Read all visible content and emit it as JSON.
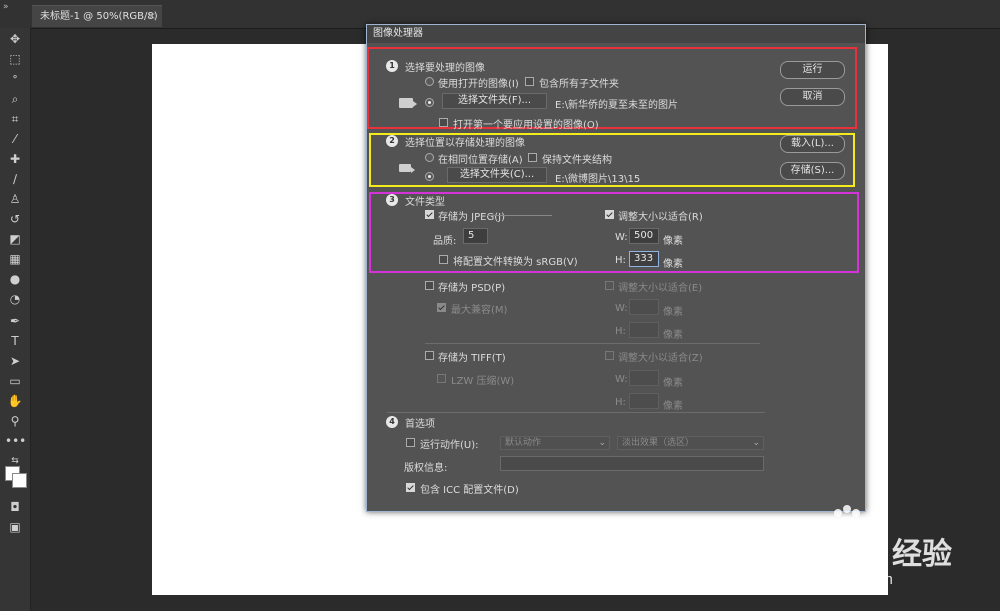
{
  "app": {
    "doc_tab": "未标题-1 @ 50%(RGB/8)",
    "tab_close": "×",
    "collapse": "»"
  },
  "dialog": {
    "title": "图像处理器",
    "sec1": {
      "num": "1",
      "heading": "选择要处理的图像",
      "use_open": "使用打开的图像(I)",
      "include_sub": "包含所有子文件夹",
      "select_folder": "选择文件夹(F)...",
      "folder_path": "E:\\新华侨的夏至未至的图片",
      "open_first": "打开第一个要应用设置的图像(O)"
    },
    "sec2": {
      "num": "2",
      "heading": "选择位置以存储处理的图像",
      "same_location": "在相同位置存储(A)",
      "keep_structure": "保持文件夹结构",
      "select_folder": "选择文件夹(C)...",
      "folder_path": "E:\\微博图片\\13\\15"
    },
    "sec3": {
      "num": "3",
      "heading": "文件类型",
      "jpeg": {
        "save_as": "存储为 JPEG(J)",
        "resize": "调整大小以适合(R)",
        "quality_label": "品质:",
        "quality": "5",
        "w_label": "W:",
        "w": "500",
        "h_label": "H:",
        "h": "333",
        "unit": "像素",
        "convert_srgb": "将配置文件转换为 sRGB(V)"
      },
      "psd": {
        "save_as": "存储为 PSD(P)",
        "resize": "调整大小以适合(E)",
        "max_compat": "最大兼容(M)",
        "w_label": "W:",
        "h_label": "H:",
        "unit": "像素"
      },
      "tiff": {
        "save_as": "存储为 TIFF(T)",
        "resize": "调整大小以适合(Z)",
        "lzw": "LZW 压缩(W)",
        "w_label": "W:",
        "h_label": "H:",
        "unit": "像素"
      }
    },
    "sec4": {
      "num": "4",
      "heading": "首选项",
      "run_action": "运行动作(U):",
      "action_set": "默认动作",
      "action": "淡出效果（选区）",
      "copyright_label": "版权信息:",
      "include_icc": "包含 ICC 配置文件(D)"
    },
    "buttons": {
      "run": "运行",
      "cancel": "取消",
      "load": "载入(L)...",
      "save": "存储(S)..."
    },
    "highlight_colors": {
      "sec1": "#e8313c",
      "sec2": "#f4ec1a",
      "sec3": "#d433d8"
    }
  },
  "watermark": {
    "brand": "Bai du",
    "brand_cn": "经验",
    "url": "jingyan.baidu.com"
  }
}
